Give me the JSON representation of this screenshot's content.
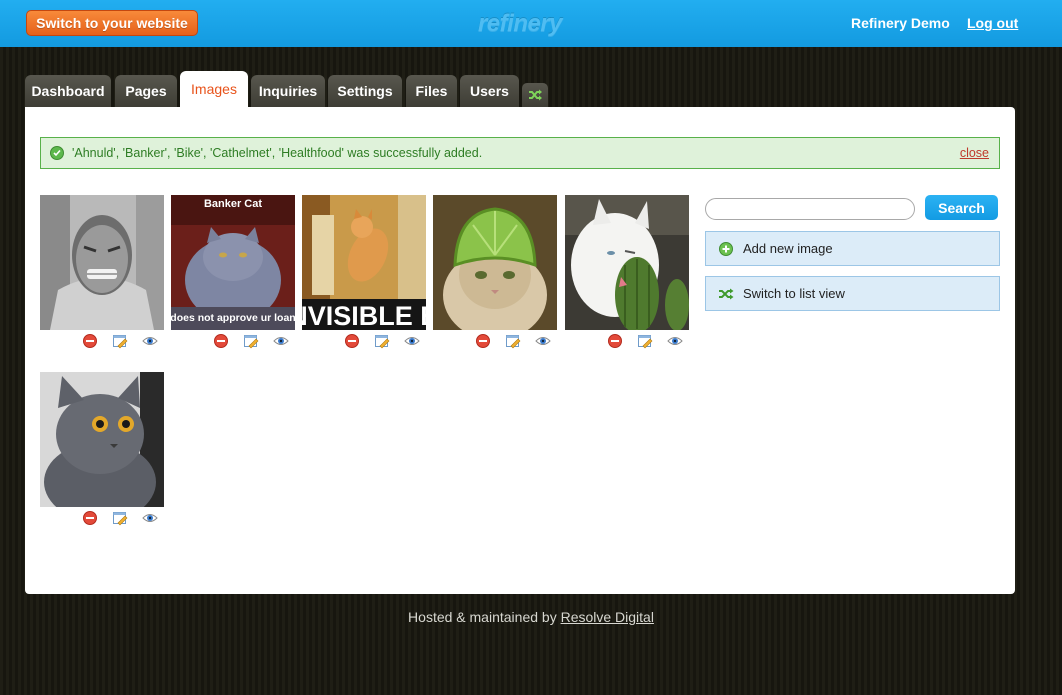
{
  "header": {
    "switch_label": "Switch to your website",
    "logo_text": "refinery",
    "site_name": "Refinery Demo",
    "logout_label": "Log out"
  },
  "tabs": [
    {
      "label": "Dashboard",
      "active": false
    },
    {
      "label": "Pages",
      "active": false
    },
    {
      "label": "Images",
      "active": true
    },
    {
      "label": "Inquiries",
      "active": false
    },
    {
      "label": "Settings",
      "active": false
    },
    {
      "label": "Files",
      "active": false
    },
    {
      "label": "Users",
      "active": false
    }
  ],
  "flash": {
    "message": "'Ahnuld', 'Banker', 'Bike', 'Cathelmet', 'Healthfood' was successfully added.",
    "close_label": "close"
  },
  "images": [
    {
      "caption_top": "",
      "caption_bottom": ""
    },
    {
      "caption_top": "Banker Cat",
      "caption_bottom": "does not approve ur loan"
    },
    {
      "caption_top": "",
      "caption_bottom": "INVISIBLE BI"
    },
    {
      "caption_top": "",
      "caption_bottom": ""
    },
    {
      "caption_top": "",
      "caption_bottom": ""
    },
    {
      "caption_top": "",
      "caption_bottom": ""
    }
  ],
  "sidebar": {
    "search_value": "",
    "search_label": "Search",
    "add_image_label": "Add new image",
    "list_view_label": "Switch to list view"
  },
  "footer": {
    "prefix": "Hosted & maintained by",
    "link_label": "Resolve Digital"
  },
  "colors": {
    "topbar": "#1aa3e8",
    "accent_orange": "#e8531b",
    "flash_bg": "#dff2da",
    "side_btn_bg": "#dcecf8"
  }
}
